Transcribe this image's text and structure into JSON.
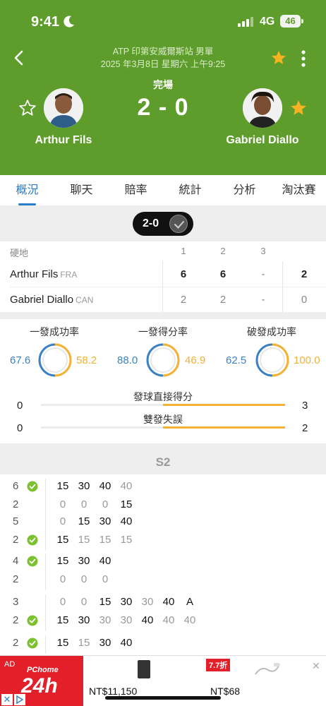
{
  "status_bar": {
    "time": "9:41",
    "network": "4G",
    "battery": "46"
  },
  "match": {
    "tournament": "ATP 印第安威爾斯站 男單",
    "datetime": "2025 年3月8日 星期六 上午9:25",
    "status": "完場",
    "score": "2 - 0",
    "player1": "Arthur Fils",
    "player2": "Gabriel Diallo"
  },
  "tabs": [
    "概況",
    "聊天",
    "賠率",
    "統計",
    "分析",
    "淘汰賽"
  ],
  "set_pill": "2-0",
  "score_table": {
    "surface": "硬地",
    "set_headers": [
      "1",
      "2",
      "3"
    ],
    "rows": [
      {
        "name": "Arthur Fils",
        "country": "FRA",
        "sets": [
          "6",
          "6",
          "-"
        ],
        "total": "2"
      },
      {
        "name": "Gabriel Diallo",
        "country": "CAN",
        "sets": [
          "2",
          "2",
          "-"
        ],
        "total": "0"
      }
    ]
  },
  "stats": {
    "donuts": [
      {
        "title": "一發成功率",
        "left": "67.6",
        "right": "58.2"
      },
      {
        "title": "一發得分率",
        "left": "88.0",
        "right": "46.9"
      },
      {
        "title": "破發成功率",
        "left": "62.5",
        "right": "100.0"
      }
    ],
    "bars": [
      {
        "title": "發球直接得分",
        "left": "0",
        "right": "3"
      },
      {
        "title": "雙發失誤",
        "left": "0",
        "right": "2"
      }
    ]
  },
  "pbp": {
    "set_label": "S2",
    "games": [
      {
        "top_num": "6",
        "top_check": true,
        "top": [
          "15",
          "30",
          "40",
          "40"
        ],
        "top_grey": [
          false,
          false,
          false,
          true
        ],
        "bot_num": "2",
        "bot_check": false,
        "bot": [
          "0",
          "0",
          "0",
          "15"
        ],
        "bot_grey": [
          true,
          true,
          true,
          false
        ]
      },
      {
        "top_num": "5",
        "top_check": false,
        "top": [
          "0",
          "15",
          "30",
          "40"
        ],
        "top_grey": [
          true,
          false,
          false,
          false
        ],
        "bot_num": "2",
        "bot_check": true,
        "bot": [
          "15",
          "15",
          "15",
          "15"
        ],
        "bot_grey": [
          false,
          true,
          true,
          true
        ]
      },
      {
        "top_num": "4",
        "top_check": true,
        "top": [
          "15",
          "30",
          "40"
        ],
        "top_grey": [
          false,
          false,
          false
        ],
        "bot_num": "2",
        "bot_check": false,
        "bot": [
          "0",
          "0",
          "0"
        ],
        "bot_grey": [
          true,
          true,
          true
        ]
      },
      {
        "top_num": "3",
        "top_check": false,
        "top": [
          "0",
          "0",
          "15",
          "30",
          "30",
          "40",
          "A"
        ],
        "top_grey": [
          true,
          true,
          false,
          false,
          true,
          false,
          false
        ],
        "bot_num": "2",
        "bot_check": true,
        "bot": [
          "15",
          "30",
          "30",
          "30",
          "40",
          "40",
          "40"
        ],
        "bot_grey": [
          false,
          false,
          true,
          true,
          false,
          true,
          true
        ]
      },
      {
        "top_num": "2",
        "top_check": true,
        "top": [
          "15",
          "15",
          "30",
          "40"
        ],
        "top_grey": [
          false,
          true,
          false,
          false
        ]
      }
    ]
  },
  "ad": {
    "tag": "AD",
    "brand": "PChome",
    "logo_text": "24h",
    "discount": "7.7折",
    "price1": "NT$11,150",
    "price2": "NT$68",
    "close": "✕",
    "choices": "✕"
  },
  "colors": {
    "header_green": "#5e9d2b",
    "accent_blue": "#2c7cc9",
    "accent_orange": "#f2b233",
    "ad_red": "#e3202a"
  }
}
